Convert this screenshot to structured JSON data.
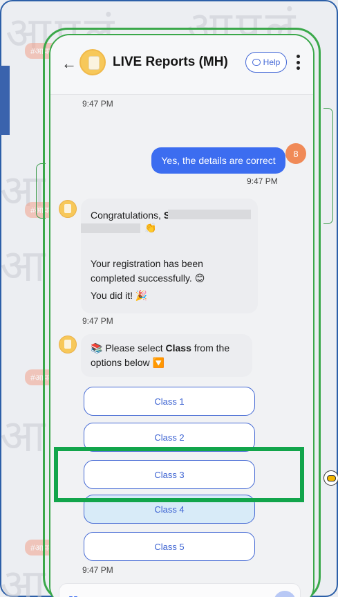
{
  "header": {
    "title": "LIVE Reports (MH)",
    "help_label": "Help",
    "back_icon": "back-arrow-icon",
    "menu_icon": "kebab-menu-icon"
  },
  "backdrop": {
    "watermark_text": "आपलं",
    "watermark_tag": "#आपलंवाचन"
  },
  "messages": {
    "time_top": "9:47 PM",
    "user_message": "Yes, the details are correct",
    "user_avatar_letter": "8",
    "user_time": "9:47 PM",
    "congrats_prefix": "Congratulations,",
    "congrats_name": "SH",
    "clap_emoji": "👏",
    "registration_text": "Your registration has been completed successfully.",
    "smile_emoji": "😊",
    "did_it_text": "You did it!",
    "party_emoji": "🎉",
    "congrats_time": "9:47 PM",
    "class_prompt_book": "📚",
    "class_prompt_pre": "Please select",
    "class_prompt_bold": "Class",
    "class_prompt_post": "from the options below",
    "class_prompt_down": "🔽",
    "options_time": "9:47 PM"
  },
  "class_options": [
    {
      "label": "Class 1",
      "selected": false
    },
    {
      "label": "Class 2",
      "selected": false
    },
    {
      "label": "Class 3",
      "selected": false
    },
    {
      "label": "Class 4",
      "selected": true
    },
    {
      "label": "Class 5",
      "selected": false
    }
  ],
  "input": {
    "placeholder": "Tap to send a message"
  },
  "colors": {
    "accent": "#3c6df0",
    "highlight": "#12a54b",
    "phone_outline": "#3aa84a",
    "selected_option": "#d8ebf8"
  }
}
